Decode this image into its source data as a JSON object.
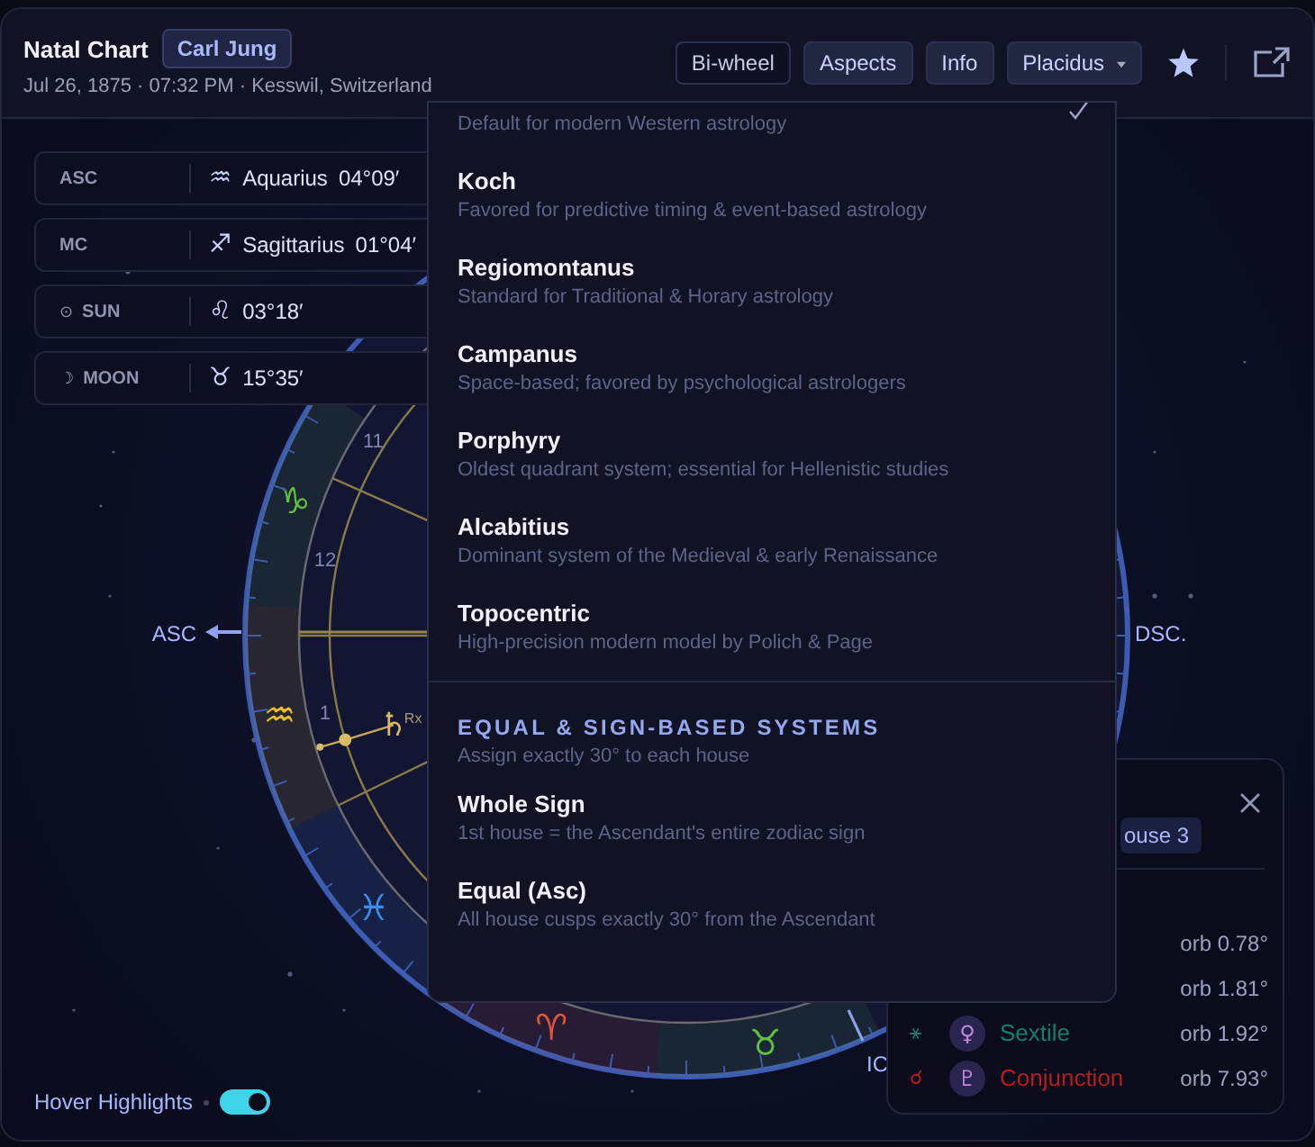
{
  "header": {
    "title": "Natal Chart",
    "person": "Carl Jung",
    "subtitle": "Jul 26, 1875 · 07:32 PM · Kesswil, Switzerland",
    "buttons": [
      {
        "label": "Bi-wheel",
        "selected": false
      },
      {
        "label": "Aspects",
        "selected": true
      },
      {
        "label": "Info",
        "selected": true
      }
    ],
    "house_system": {
      "label": "Placidus",
      "expanded": true
    }
  },
  "positions": [
    {
      "label": "ASC",
      "glyph": "♒",
      "sign": "Aquarius",
      "degree": "04°09′"
    },
    {
      "label": "MC",
      "glyph": "♐",
      "sign": "Sagittarius",
      "degree": "01°04′"
    },
    {
      "symbol": "⊙",
      "label": "SUN",
      "glyph": "♌",
      "degree": "03°18′"
    },
    {
      "symbol": "☽",
      "label": "MOON",
      "glyph": "♉",
      "degree": "15°35′"
    }
  ],
  "wheel": {
    "signs": [
      {
        "glyph": "♑",
        "color": "#5fbf3f"
      },
      {
        "glyph": "♒",
        "color": "#e8c02a"
      },
      {
        "glyph": "♓",
        "color": "#3a8ee8"
      },
      {
        "glyph": "♈",
        "color": "#e0553a"
      },
      {
        "glyph": "♉",
        "color": "#5fbf3f"
      }
    ],
    "houses": [
      "11",
      "12",
      "1"
    ],
    "angles": [
      {
        "kind": "asc",
        "label": "ASC"
      },
      {
        "kind": "dsc",
        "label": "DSC."
      },
      {
        "kind": "ic",
        "label": "IC"
      }
    ],
    "planet": {
      "glyph": "♄",
      "note": "Rx"
    }
  },
  "house_menu": {
    "groups": [
      {
        "items": [
          {
            "description": "Default for modern Western astrology",
            "selected": true
          },
          {
            "name": "Koch",
            "description": "Favored for predictive timing & event-based astrology",
            "selected": false
          },
          {
            "name": "Regiomontanus",
            "description": "Standard for Traditional & Horary astrology",
            "selected": false
          },
          {
            "name": "Campanus",
            "description": "Space-based; favored by psychological astrologers",
            "selected": false
          },
          {
            "name": "Porphyry",
            "description": "Oldest quadrant system; essential for Hellenistic studies",
            "selected": false
          },
          {
            "name": "Alcabitius",
            "description": "Dominant system of the Medieval & early Renaissance",
            "selected": false
          },
          {
            "name": "Topocentric",
            "description": "High-precision modern model by Polich & Page",
            "selected": false
          }
        ]
      },
      {
        "heading": "EQUAL & SIGN-BASED SYSTEMS",
        "description": "Assign exactly 30° to each house",
        "items": [
          {
            "name": "Whole Sign",
            "description": "1st house = the Ascendant's entire zodiac sign",
            "selected": false
          },
          {
            "name": "Equal (Asc)",
            "description": "All house cusps exactly 30° from the Ascendant",
            "selected": false
          }
        ]
      }
    ]
  },
  "aspect_panel": {
    "tag": "ouse 3",
    "rows": [
      {
        "orb": "orb 0.78°"
      },
      {
        "orb": "orb 1.81°"
      },
      {
        "symbol": "⚹",
        "planet": "♀",
        "name": "Sextile",
        "color": "#12806a",
        "orb": "orb 1.92°"
      },
      {
        "symbol": "☌",
        "planet": "♇",
        "name": "Conjunction",
        "color": "#b81d1d",
        "orb": "orb 7.93°"
      }
    ]
  },
  "hover_highlights": {
    "label": "Hover Highlights",
    "on": true
  }
}
